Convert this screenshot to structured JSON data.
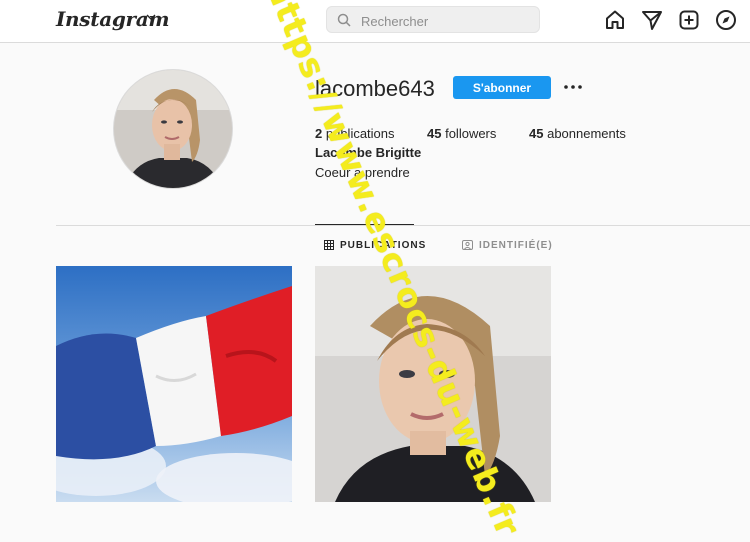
{
  "nav": {
    "logo": "Instagram",
    "search_placeholder": "Rechercher"
  },
  "profile": {
    "username": "lacombe643",
    "follow_label": "S'abonner",
    "stats": {
      "publications_count": "2",
      "publications_label": "publications",
      "followers_count": "45",
      "followers_label": "followers",
      "following_count": "45",
      "following_label": "abonnements"
    },
    "full_name": "Lacombe Brigitte",
    "bio": "Coeur a prendre"
  },
  "tabs": [
    {
      "label": "PUBLICATIONS",
      "icon": "grid-icon",
      "active": true
    },
    {
      "label": "IDENTIFIÉ(E)",
      "icon": "tag-icon",
      "active": false
    }
  ],
  "posts": [
    {
      "subject": "french-flag",
      "icon": "flag-image"
    },
    {
      "subject": "woman-portrait",
      "icon": "portrait-image"
    }
  ],
  "watermark": "https://www.escrocs-du-web.fr",
  "colors": {
    "accent": "#1a97f0",
    "watermark": "#f4ec1e",
    "flag_blue": "#2c4fa3",
    "flag_red": "#e01e26"
  }
}
